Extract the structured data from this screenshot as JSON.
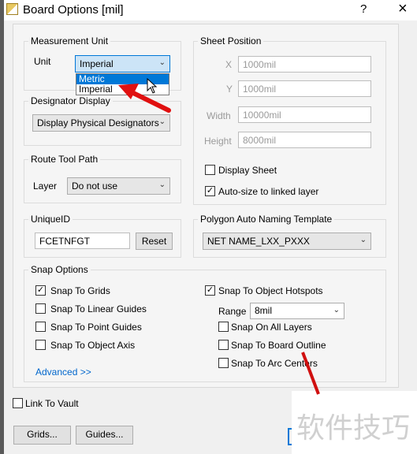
{
  "window": {
    "title": "Board Options [mil]",
    "help": "?",
    "close": "×"
  },
  "measurement": {
    "label": "Measurement Unit",
    "unit_label": "Unit",
    "unit_value": "Imperial",
    "options": [
      "Metric",
      "Imperial"
    ],
    "highlighted": "Metric"
  },
  "designator": {
    "label": "Designator Display",
    "value": "Display Physical Designators"
  },
  "route": {
    "label": "Route Tool Path",
    "layer_label": "Layer",
    "layer_value": "Do not use"
  },
  "unique": {
    "label": "UniqueID",
    "value": "FCETNFGT",
    "reset": "Reset"
  },
  "sheet": {
    "label": "Sheet Position",
    "x_label": "X",
    "x": "1000mil",
    "y_label": "Y",
    "y": "1000mil",
    "w_label": "Width",
    "w": "10000mil",
    "h_label": "Height",
    "h": "8000mil",
    "display_sheet": "Display Sheet",
    "display_sheet_checked": false,
    "autosize": "Auto-size to linked layer",
    "autosize_checked": true
  },
  "polygon": {
    "label": "Polygon Auto Naming Template",
    "value": "NET NAME_LXX_PXXX"
  },
  "snap": {
    "label": "Snap Options",
    "grids": "Snap To Grids",
    "linear": "Snap To Linear Guides",
    "point": "Snap To Point Guides",
    "axis": "Snap To Object Axis",
    "advanced": "Advanced >>",
    "hotspots": "Snap To Object Hotspots",
    "range_label": "Range",
    "range": "8mil",
    "all_layers": "Snap On All Layers",
    "board_outline": "Snap To Board Outline",
    "arc_centers": "Snap To Arc Centers"
  },
  "link_vault": "Link To Vault",
  "buttons": {
    "grids": "Grids...",
    "guides": "Guides..."
  },
  "watermark": "软件技巧",
  "colors": {
    "accent": "#0078d7",
    "arrow": "#e01010"
  }
}
